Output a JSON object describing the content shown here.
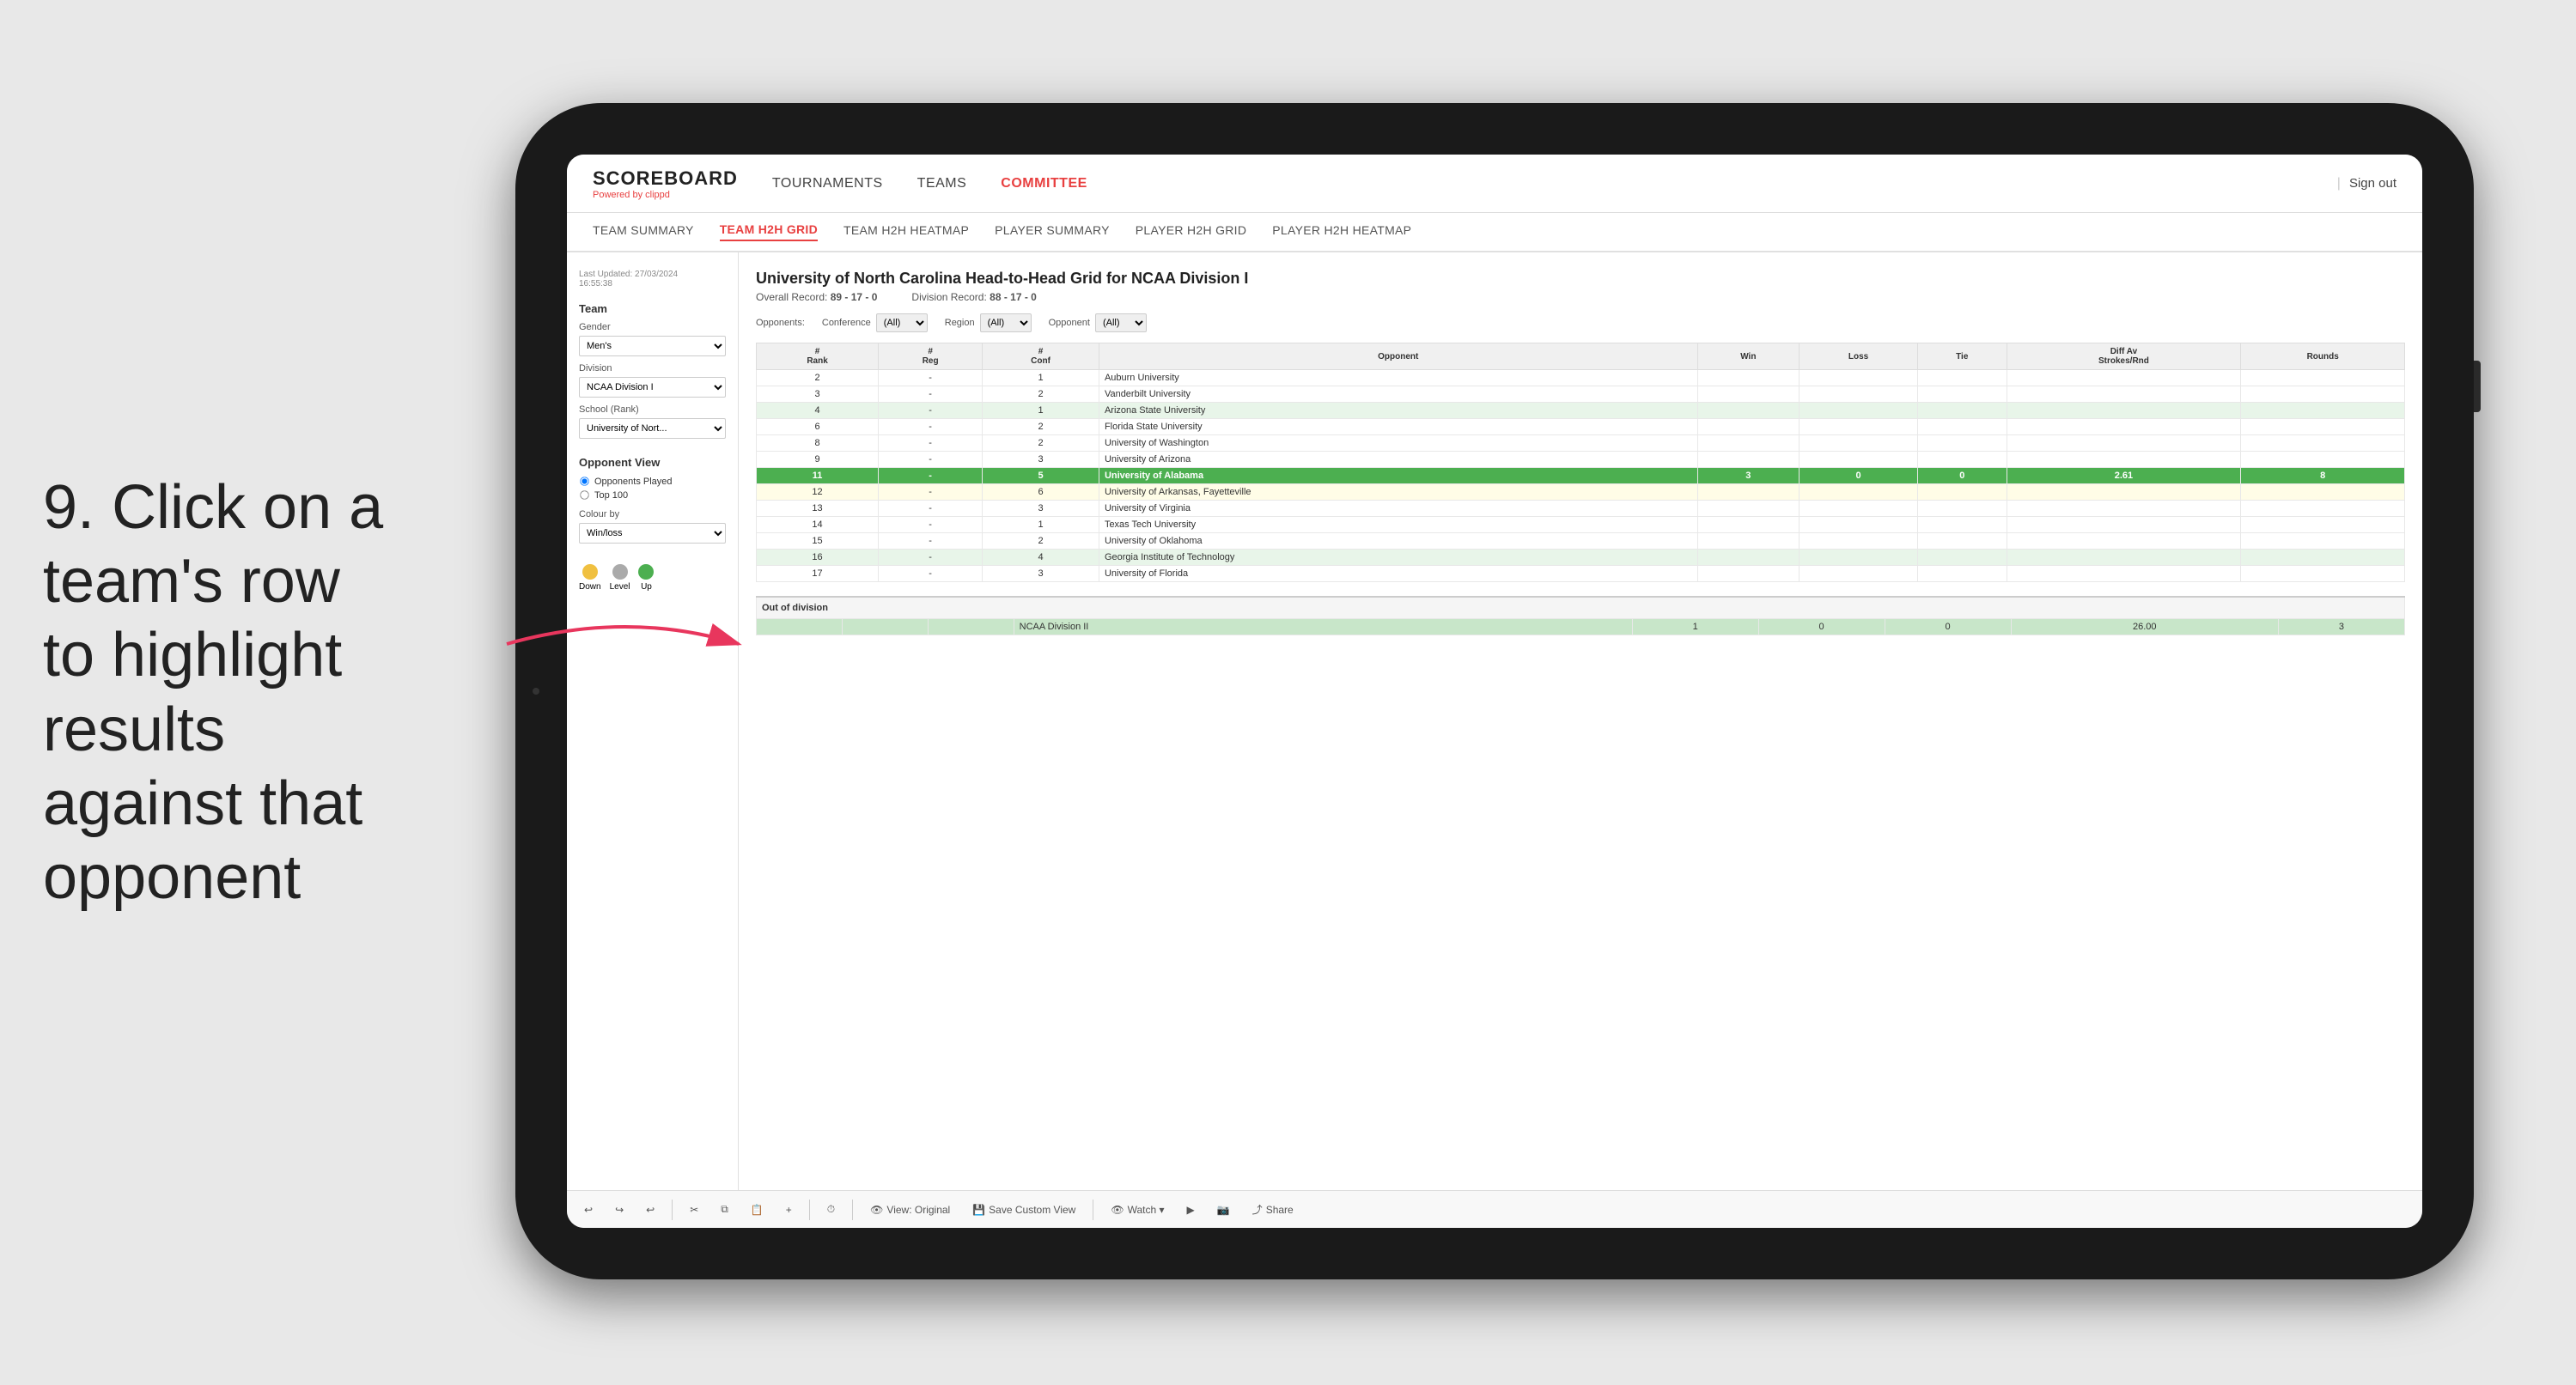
{
  "instruction": {
    "number": "9.",
    "text": "Click on a team's row to highlight results against that opponent"
  },
  "app": {
    "logo": "SCOREBOARD",
    "logo_powered": "Powered by",
    "logo_brand": "clippd",
    "nav_items": [
      "TOURNAMENTS",
      "TEAMS",
      "COMMITTEE"
    ],
    "active_nav": "COMMITTEE",
    "sign_in": "Sign out",
    "sub_nav_items": [
      "TEAM SUMMARY",
      "TEAM H2H GRID",
      "TEAM H2H HEATMAP",
      "PLAYER SUMMARY",
      "PLAYER H2H GRID",
      "PLAYER H2H HEATMAP"
    ],
    "active_sub_nav": "TEAM H2H GRID"
  },
  "sidebar": {
    "last_updated_label": "Last Updated: 27/03/2024",
    "last_updated_time": "16:55:38",
    "team_label": "Team",
    "gender_label": "Gender",
    "gender_value": "Men's",
    "division_label": "Division",
    "division_value": "NCAA Division I",
    "school_label": "School (Rank)",
    "school_value": "University of Nort...",
    "opponent_view_label": "Opponent View",
    "radio_opponents": "Opponents Played",
    "radio_top100": "Top 100",
    "colour_label": "Colour by",
    "colour_value": "Win/loss",
    "legend_down": "Down",
    "legend_level": "Level",
    "legend_up": "Up"
  },
  "grid": {
    "title": "University of North Carolina Head-to-Head Grid for NCAA Division I",
    "overall_record_label": "Overall Record:",
    "overall_record": "89 - 17 - 0",
    "division_record_label": "Division Record:",
    "division_record": "88 - 17 - 0",
    "filter_opponents_label": "Opponents:",
    "filter_conference_label": "Conference",
    "filter_region_label": "Region",
    "filter_opponent_label": "Opponent",
    "columns": [
      "#\nRank",
      "#\nReg",
      "#\nConf",
      "Opponent",
      "Win",
      "Loss",
      "Tie",
      "Diff Av\nStrokes/Rnd",
      "Rounds"
    ],
    "rows": [
      {
        "rank": "2",
        "reg": "-",
        "conf": "1",
        "opponent": "Auburn University",
        "win": "",
        "loss": "",
        "tie": "",
        "diff": "",
        "rounds": "",
        "style": "normal"
      },
      {
        "rank": "3",
        "reg": "-",
        "conf": "2",
        "opponent": "Vanderbilt University",
        "win": "",
        "loss": "",
        "tie": "",
        "diff": "",
        "rounds": "",
        "style": "normal"
      },
      {
        "rank": "4",
        "reg": "-",
        "conf": "1",
        "opponent": "Arizona State University",
        "win": "",
        "loss": "",
        "tie": "",
        "diff": "",
        "rounds": "",
        "style": "light-green"
      },
      {
        "rank": "6",
        "reg": "-",
        "conf": "2",
        "opponent": "Florida State University",
        "win": "",
        "loss": "",
        "tie": "",
        "diff": "",
        "rounds": "",
        "style": "normal"
      },
      {
        "rank": "8",
        "reg": "-",
        "conf": "2",
        "opponent": "University of Washington",
        "win": "",
        "loss": "",
        "tie": "",
        "diff": "",
        "rounds": "",
        "style": "normal"
      },
      {
        "rank": "9",
        "reg": "-",
        "conf": "3",
        "opponent": "University of Arizona",
        "win": "",
        "loss": "",
        "tie": "",
        "diff": "",
        "rounds": "",
        "style": "normal"
      },
      {
        "rank": "11",
        "reg": "-",
        "conf": "5",
        "opponent": "University of Alabama",
        "win": "3",
        "loss": "0",
        "tie": "0",
        "diff": "2.61",
        "rounds": "8",
        "style": "highlighted"
      },
      {
        "rank": "12",
        "reg": "-",
        "conf": "6",
        "opponent": "University of Arkansas, Fayetteville",
        "win": "",
        "loss": "",
        "tie": "",
        "diff": "",
        "rounds": "",
        "style": "light-yellow"
      },
      {
        "rank": "13",
        "reg": "-",
        "conf": "3",
        "opponent": "University of Virginia",
        "win": "",
        "loss": "",
        "tie": "",
        "diff": "",
        "rounds": "",
        "style": "normal"
      },
      {
        "rank": "14",
        "reg": "-",
        "conf": "1",
        "opponent": "Texas Tech University",
        "win": "",
        "loss": "",
        "tie": "",
        "diff": "",
        "rounds": "",
        "style": "normal"
      },
      {
        "rank": "15",
        "reg": "-",
        "conf": "2",
        "opponent": "University of Oklahoma",
        "win": "",
        "loss": "",
        "tie": "",
        "diff": "",
        "rounds": "",
        "style": "normal"
      },
      {
        "rank": "16",
        "reg": "-",
        "conf": "4",
        "opponent": "Georgia Institute of Technology",
        "win": "",
        "loss": "",
        "tie": "",
        "diff": "",
        "rounds": "",
        "style": "light-green"
      },
      {
        "rank": "17",
        "reg": "-",
        "conf": "3",
        "opponent": "University of Florida",
        "win": "",
        "loss": "",
        "tie": "",
        "diff": "",
        "rounds": "",
        "style": "normal"
      }
    ],
    "out_of_division_label": "Out of division",
    "out_of_division_row": {
      "division": "NCAA Division II",
      "win": "1",
      "loss": "0",
      "tie": "0",
      "diff": "26.00",
      "rounds": "3"
    }
  },
  "toolbar": {
    "undo": "↩",
    "redo": "↪",
    "view_original": "View: Original",
    "save_custom": "Save Custom View",
    "watch": "Watch ▾",
    "share": "Share"
  }
}
